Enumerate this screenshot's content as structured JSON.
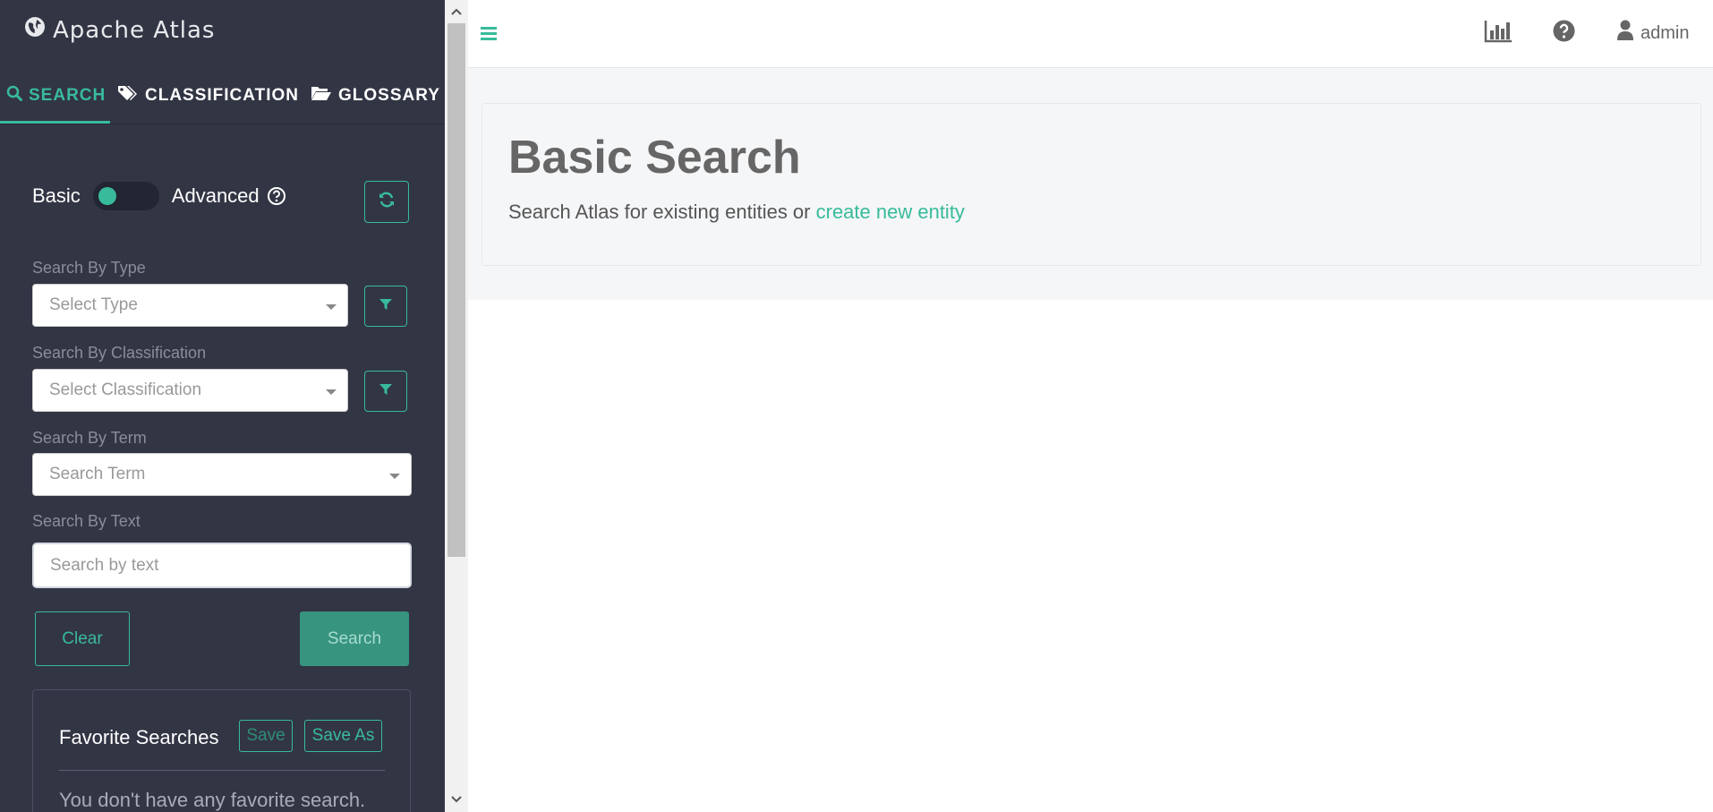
{
  "app": {
    "title": "Apache Atlas"
  },
  "tabs": [
    {
      "label": "SEARCH",
      "icon": "search-icon",
      "active": true
    },
    {
      "label": "CLASSIFICATION",
      "icon": "tags-icon",
      "active": false
    },
    {
      "label": "GLOSSARY",
      "icon": "folder-open-icon",
      "active": false
    }
  ],
  "search_panel": {
    "mode_basic": "Basic",
    "mode_advanced": "Advanced",
    "type": {
      "label": "Search By Type",
      "placeholder": "Select Type"
    },
    "classification": {
      "label": "Search By Classification",
      "placeholder": "Select Classification"
    },
    "term": {
      "label": "Search By Term",
      "placeholder": "Search Term"
    },
    "text": {
      "label": "Search By Text",
      "placeholder": "Search by text"
    },
    "clear_label": "Clear",
    "search_label": "Search"
  },
  "favorites": {
    "title": "Favorite Searches",
    "save_label": "Save",
    "save_as_label": "Save As",
    "empty_text": "You don't have any favorite search."
  },
  "header": {
    "user": "admin"
  },
  "main": {
    "title": "Basic Search",
    "subtitle_prefix": "Search Atlas for existing entities or ",
    "subtitle_link": "create new entity"
  },
  "colors": {
    "accent": "#38bb9b",
    "sidebar_bg": "#323544",
    "content_bg": "#f5f6f8"
  }
}
